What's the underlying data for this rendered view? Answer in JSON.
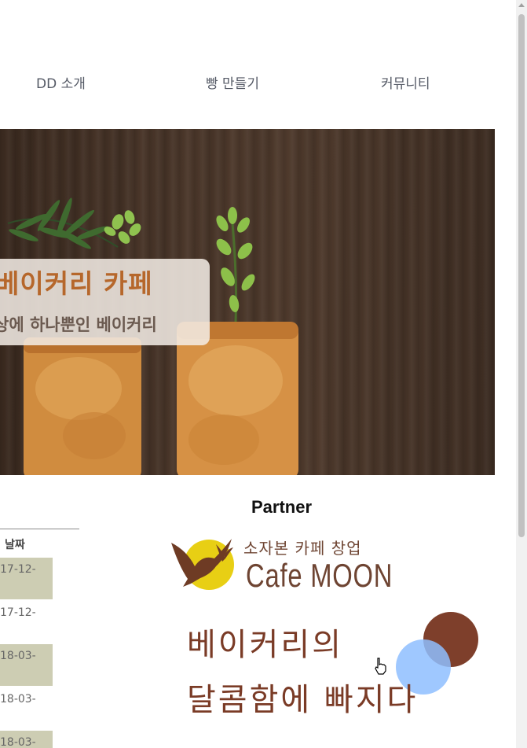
{
  "nav": {
    "items": [
      {
        "label": "DD 소개"
      },
      {
        "label": "빵 만들기"
      },
      {
        "label": "커뮤니티"
      }
    ]
  },
  "hero": {
    "title": "베이커리 카페",
    "subtitle": "상에 하나뿐인 베이커리"
  },
  "table": {
    "header": "날짜",
    "rows": [
      {
        "date": "17-12-"
      },
      {
        "date": "17-12-"
      },
      {
        "date": "18-03-"
      },
      {
        "date": "18-03-"
      },
      {
        "date": "18-03-"
      }
    ]
  },
  "partner": {
    "title": "Partner",
    "logo_tagline": "소자본 카페 창업",
    "logo_name": "Cafe MOON",
    "ad_line1": "베이커리의",
    "ad_line2": "달콤함에 빠지다"
  },
  "colors": {
    "accent": "#b6672b",
    "ad_text": "#7a3b26",
    "brown_circle": "#7e3f2b",
    "blue_circle": "#8ebeff",
    "table_shade": "#cdcdb3"
  },
  "icons": {
    "cursor": "hand-pointer-icon",
    "logo": "bird-moon-icon"
  }
}
